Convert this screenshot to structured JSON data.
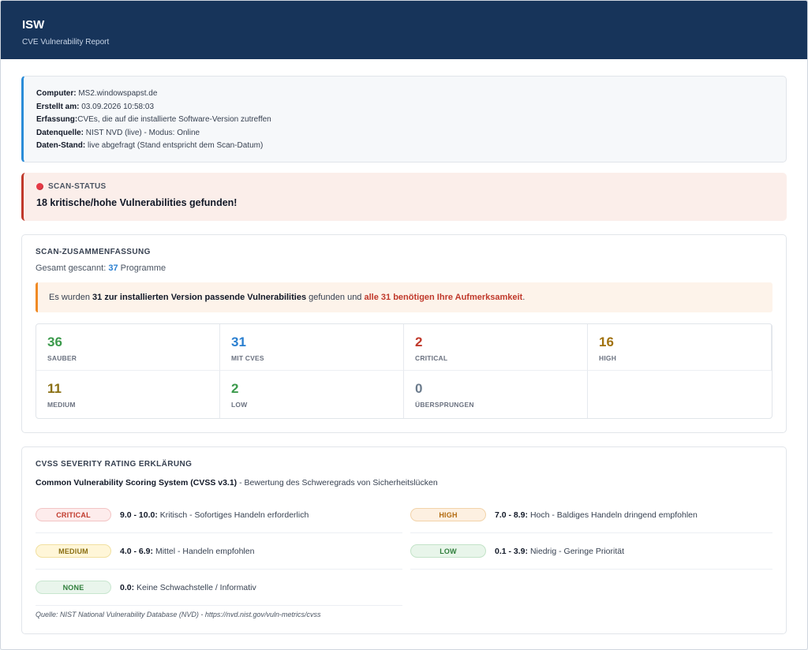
{
  "header": {
    "title": "ISW",
    "subtitle": "CVE Vulnerability Report"
  },
  "info": {
    "computer_label": "Computer:",
    "computer_value": "MS2.windowspapst.de",
    "created_label": "Erstellt am:",
    "created_value": "03.09.2026 10:58:03",
    "scope_label": "Erfassung:",
    "scope_value": "CVEs, die auf die installierte Software-Version zutreffen",
    "source_label": "Datenquelle:",
    "source_value": "NIST NVD (live) - Modus: Online",
    "state_label": "Daten-Stand:",
    "state_value": "live abgefragt (Stand entspricht dem Scan-Datum)"
  },
  "scan_status": {
    "heading": "SCAN-STATUS",
    "message": "18 kritische/hohe Vulnerabilities gefunden!",
    "status_color": "#e63946"
  },
  "summary": {
    "heading": "SCAN-ZUSAMMENFASSUNG",
    "total_prefix": "Gesamt gescannt:",
    "total_count": "37",
    "total_suffix": "Programme",
    "alert_prefix": "Es wurden",
    "alert_bold": "31 zur installierten Version passende Vulnerabilities",
    "alert_middle": "gefunden und",
    "alert_red": "alle 31 benötigen Ihre Aufmerksamkeit",
    "alert_end": ".",
    "stats": [
      {
        "value": "36",
        "label": "SAUBER"
      },
      {
        "value": "31",
        "label": "MIT CVES"
      },
      {
        "value": "2",
        "label": "CRITICAL"
      },
      {
        "value": "16",
        "label": "HIGH"
      },
      {
        "value": "11",
        "label": "MEDIUM"
      },
      {
        "value": "2",
        "label": "LOW"
      },
      {
        "value": "0",
        "label": "ÜBERSPRUNGEN"
      }
    ]
  },
  "cvss": {
    "heading": "CVSS SEVERITY RATING ERKLÄRUNG",
    "intro_bold": "Common Vulnerability Scoring System (CVSS v3.1)",
    "intro_rest": "- Bewertung des Schweregrads von Sicherheitslücken",
    "ratings": [
      {
        "badge": "CRITICAL",
        "range": "9.0 - 10.0:",
        "text": "Kritisch - Sofortiges Handeln erforderlich"
      },
      {
        "badge": "HIGH",
        "range": "7.0 - 8.9:",
        "text": "Hoch - Baldiges Handeln dringend empfohlen"
      },
      {
        "badge": "MEDIUM",
        "range": "4.0 - 6.9:",
        "text": "Mittel - Handeln empfohlen"
      },
      {
        "badge": "LOW",
        "range": "0.1 - 3.9:",
        "text": "Niedrig - Geringe Priorität"
      },
      {
        "badge": "NONE",
        "range": "0.0:",
        "text": "Keine Schwachstelle / Informativ"
      }
    ],
    "source": "Quelle: NIST National Vulnerability Database (NVD) - https://nvd.nist.gov/vuln-metrics/cvss"
  }
}
